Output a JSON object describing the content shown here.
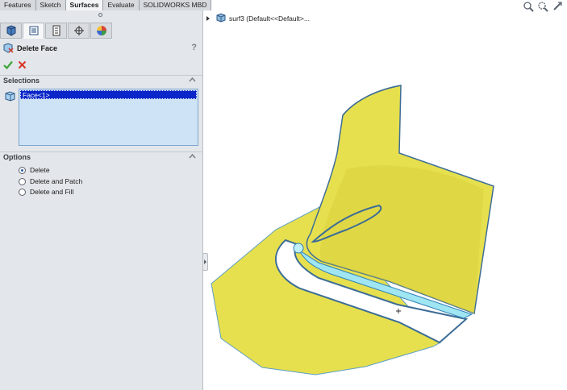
{
  "command_tabs": [
    {
      "label": "Features",
      "active": false
    },
    {
      "label": "Sketch",
      "active": false
    },
    {
      "label": "Surfaces",
      "active": true
    },
    {
      "label": "Evaluate",
      "active": false
    },
    {
      "label": "SOLIDWORKS MBD",
      "active": false
    }
  ],
  "manager_tabs": [
    "feature-manager-icon",
    "property-manager-icon",
    "configuration-manager-icon",
    "dimxpert-manager-icon",
    "display-manager-icon"
  ],
  "property_manager": {
    "title": "Delete Face",
    "help": "?",
    "ok_icon": "checkmark-icon",
    "cancel_icon": "x-icon"
  },
  "selections": {
    "header": "Selections",
    "items": [
      "Face<1>"
    ]
  },
  "options": {
    "header": "Options",
    "radios": [
      {
        "label": "Delete",
        "checked": true
      },
      {
        "label": "Delete and Patch",
        "checked": false
      },
      {
        "label": "Delete and Fill",
        "checked": false
      }
    ]
  },
  "tree": {
    "label": "surf3  (Default<<Default>..."
  },
  "colors": {
    "surface_yellow": "#e6e04e",
    "surface_edge": "#3d6d96",
    "highlight_cyan": "#9fe6f2",
    "selection_blue": "#0a26c8"
  }
}
